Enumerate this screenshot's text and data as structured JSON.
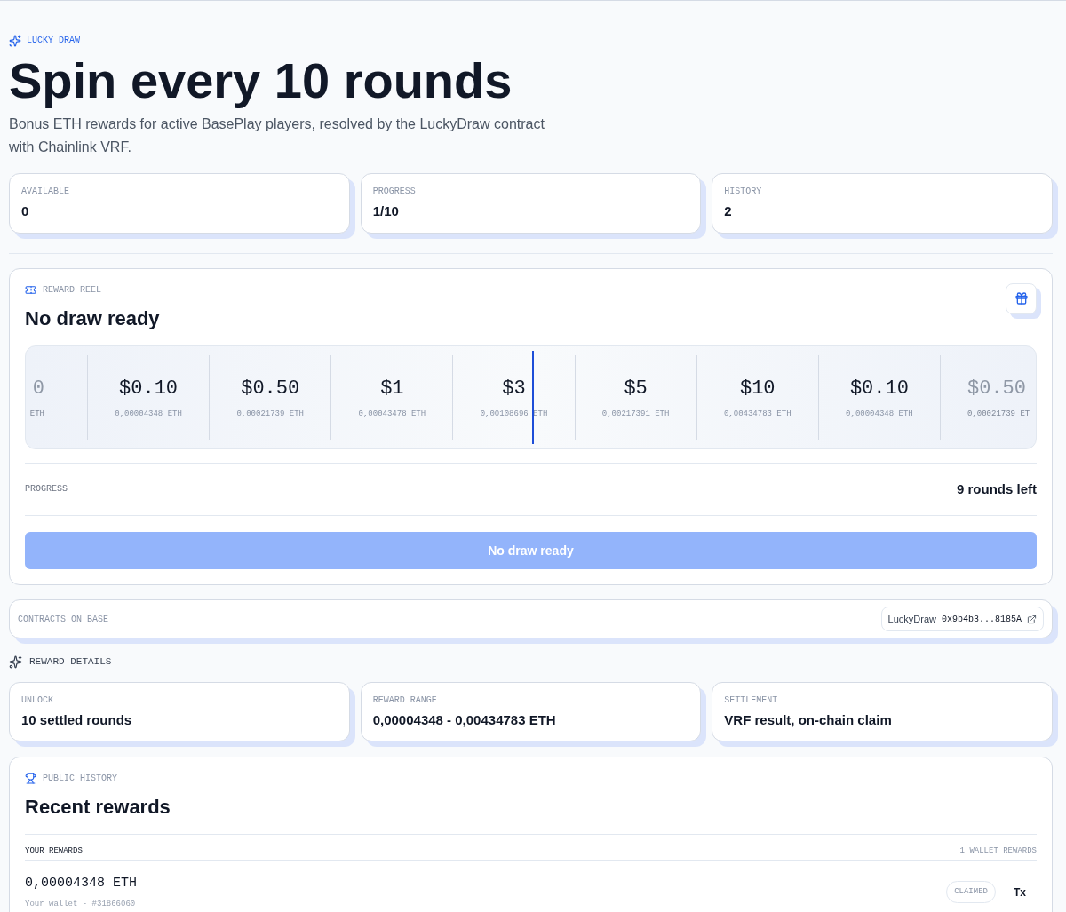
{
  "eyebrow": "LUCKY DRAW",
  "title": "Spin every 10 rounds",
  "subtitle": "Bonus ETH rewards for active BasePlay players, resolved by the LuckyDraw contract with Chainlink VRF.",
  "stats": [
    {
      "label": "AVAILABLE",
      "value": "0"
    },
    {
      "label": "PROGRESS",
      "value": "1/10"
    },
    {
      "label": "HISTORY",
      "value": "2"
    }
  ],
  "reel_card": {
    "eyebrow": "REWARD REEL",
    "title": "No draw ready",
    "reel": [
      {
        "kind": "partial-left",
        "value": "0",
        "eth": "ETH"
      },
      {
        "kind": "full",
        "value": "$0.10",
        "eth": "0,00004348 ETH"
      },
      {
        "kind": "full",
        "value": "$0.50",
        "eth": "0,00021739 ETH"
      },
      {
        "kind": "full",
        "value": "$1",
        "eth": "0,00043478 ETH"
      },
      {
        "kind": "full",
        "value": "$3",
        "eth": "0,00108696 ETH"
      },
      {
        "kind": "full",
        "value": "$5",
        "eth": "0,00217391 ETH"
      },
      {
        "kind": "full",
        "value": "$10",
        "eth": "0,00434783 ETH"
      },
      {
        "kind": "full",
        "value": "$0.10",
        "eth": "0,00004348 ETH"
      },
      {
        "kind": "partial-right",
        "value": "$0.50",
        "eth": "0,00021739 ET"
      }
    ],
    "progress_label": "PROGRESS",
    "progress_value": "9 rounds left",
    "button": {
      "label": "No draw ready",
      "disabled": true
    }
  },
  "contracts": {
    "label": "CONTRACTS ON BASE",
    "chip": {
      "name": "LuckyDraw",
      "address": "0x9b4b3...8185A"
    }
  },
  "details": {
    "heading": "REWARD DETAILS",
    "items": [
      {
        "label": "UNLOCK",
        "value": "10 settled rounds"
      },
      {
        "label": "REWARD RANGE",
        "value": "0,00004348 - 0,00434783 ETH"
      },
      {
        "label": "SETTLEMENT",
        "value": "VRF result, on-chain claim"
      }
    ]
  },
  "history": {
    "eyebrow": "PUBLIC HISTORY",
    "title": "Recent rewards",
    "section": "YOUR REWARDS",
    "count": "1 WALLET REWARDS",
    "rows": [
      {
        "amount": "0,00004348 ETH",
        "meta": "Your wallet - #31866060",
        "status": "CLAIMED",
        "link": "Tx"
      }
    ]
  }
}
